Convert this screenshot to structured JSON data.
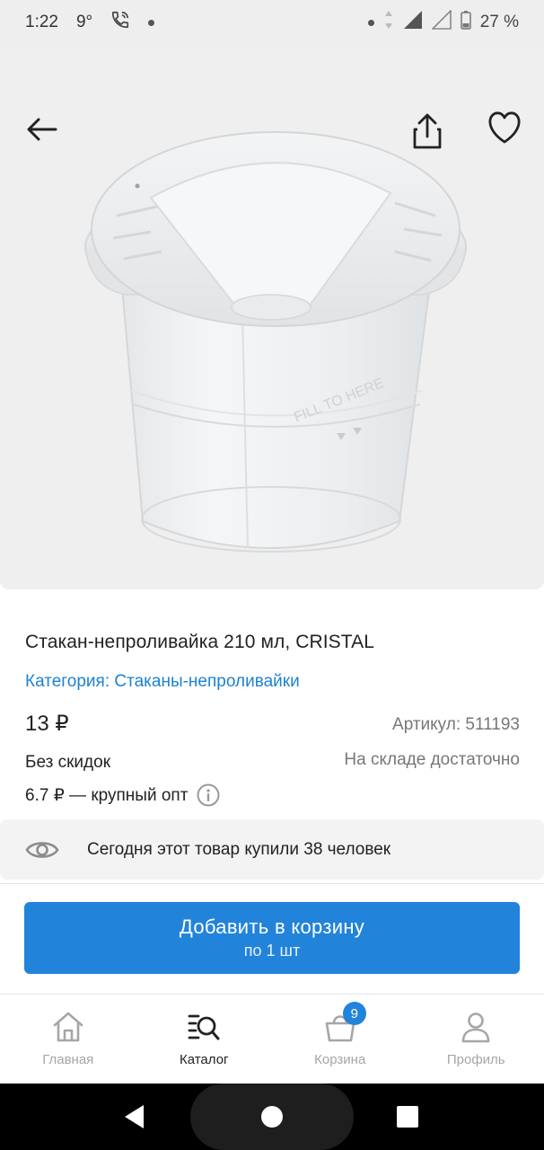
{
  "status_bar": {
    "time": "1:22",
    "temperature": "9°",
    "battery": "27 %"
  },
  "product": {
    "title": "Стакан-непроливайка 210 мл, CRISTAL",
    "category": "Категория: Стаканы-непроливайки",
    "price": "13 ₽",
    "article": "Артикул: 511193",
    "discount": "Без скидок",
    "stock": "На складе достаточно",
    "wholesale": "6.7 ₽ — крупный опт",
    "image_text": "FILL TO HERE"
  },
  "bought_today": {
    "text": "Сегодня этот товар купили 38 человек"
  },
  "cart_button": {
    "label": "Добавить в корзину",
    "sublabel": "по 1 шт"
  },
  "bottom_nav": {
    "items": [
      {
        "label": "Главная",
        "icon": "home-icon"
      },
      {
        "label": "Каталог",
        "icon": "catalog-search-icon"
      },
      {
        "label": "Корзина",
        "icon": "cart-bag-icon",
        "badge": "9"
      },
      {
        "label": "Профиль",
        "icon": "profile-icon"
      }
    ],
    "active": "Каталог"
  },
  "colors": {
    "accent": "#2283da",
    "link": "#1e82d2",
    "muted": "#777777",
    "image_bg": "#efefef"
  }
}
